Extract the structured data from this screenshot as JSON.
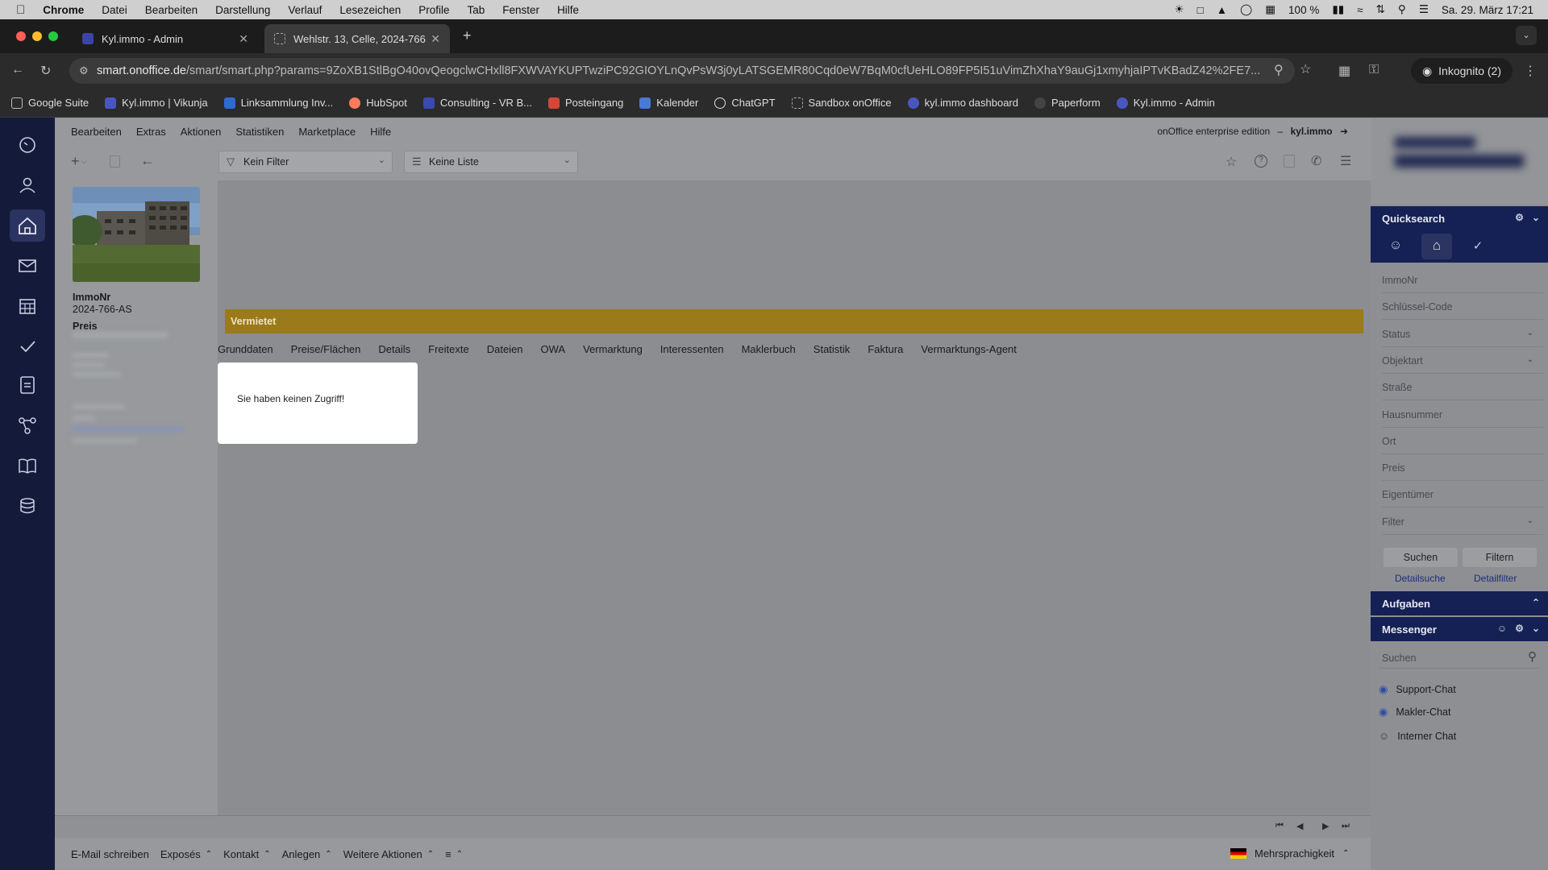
{
  "menubar": {
    "app": "Chrome",
    "items": [
      "Datei",
      "Bearbeiten",
      "Darstellung",
      "Verlauf",
      "Lesezeichen",
      "Profile",
      "Tab",
      "Fenster",
      "Hilfe"
    ],
    "battery": "100 %",
    "datetime": "Sa. 29. März  17:21"
  },
  "tabs": [
    {
      "title": "Kyl.immo - Admin",
      "active": false
    },
    {
      "title": "Wehlstr. 13, Celle, 2024-766",
      "active": true
    }
  ],
  "address": {
    "host": "smart.onoffice.de",
    "path": "/smart/smart.php?params=9ZoXB1StlBgO40ovQeogclwCHxll8FXWVAYKUPTwziPC92GIOYLnQvPsW3j0yLATSGEMR80Cqd0eW7BqM0cfUeHLO89FP5I51uVimZhXhaY9auGj1xmyhjaIPTvKBadZ42%2FE7...",
    "incognito": "Inkognito (2)"
  },
  "bookmarks": [
    "Google Suite",
    "Kyl.immo | Vikunja",
    "Linksammlung Inv...",
    "HubSpot",
    "Consulting - VR B...",
    "Posteingang",
    "Kalender",
    "ChatGPT",
    "Sandbox onOffice",
    "kyl.immo dashboard",
    "Paperform",
    "Kyl.immo - Admin"
  ],
  "mainmenu": {
    "items": [
      "Bearbeiten",
      "Extras",
      "Aktionen",
      "Statistiken",
      "Marketplace",
      "Hilfe"
    ],
    "edition": "onOffice enterprise edition",
    "separator": "–",
    "user": "kyl.immo"
  },
  "toolbar": {
    "filter": "Kein Filter",
    "list": "Keine Liste"
  },
  "property": {
    "immonr_label": "ImmoNr",
    "immonr": "2024-766-AS",
    "price_label": "Preis",
    "status": "Vermietet"
  },
  "object_tabs": [
    "Grunddaten",
    "Preise/Flächen",
    "Details",
    "Freitexte",
    "Dateien",
    "OWA",
    "Vermarktung",
    "Interessenten",
    "Maklerbuch",
    "Statistik",
    "Faktura",
    "Vermarktungs-Agent"
  ],
  "dialog": {
    "message": "Sie haben keinen Zugriff!"
  },
  "bottombar": {
    "actions": [
      "E-Mail schreiben",
      "Exposés",
      "Kontakt",
      "Anlegen",
      "Weitere Aktionen"
    ],
    "language": "Mehrsprachigkeit"
  },
  "quicksearch": {
    "title": "Quicksearch",
    "fields": [
      {
        "label": "ImmoNr",
        "dropdown": false
      },
      {
        "label": "Schlüssel-Code",
        "dropdown": false
      },
      {
        "label": "Status",
        "dropdown": true
      },
      {
        "label": "Objektart",
        "dropdown": true
      },
      {
        "label": "Straße",
        "dropdown": false
      },
      {
        "label": "Hausnummer",
        "dropdown": false
      },
      {
        "label": "Ort",
        "dropdown": false
      },
      {
        "label": "Preis",
        "dropdown": false
      },
      {
        "label": "Eigentümer",
        "dropdown": false
      },
      {
        "label": "Filter",
        "dropdown": true
      }
    ],
    "search_button": "Suchen",
    "filter_button": "Filtern",
    "detail_search": "Detailsuche",
    "detail_filter": "Detailfilter"
  },
  "aufgaben": {
    "title": "Aufgaben"
  },
  "messenger": {
    "title": "Messenger",
    "search_placeholder": "Suchen",
    "chats": [
      "Support-Chat",
      "Makler-Chat",
      "Interner Chat"
    ]
  },
  "colors": {
    "sidebar_dark": "#141a3a",
    "panel_header": "#152054",
    "status_gold": "#9a7a1a",
    "overlay_gray": "#8b8d90"
  }
}
